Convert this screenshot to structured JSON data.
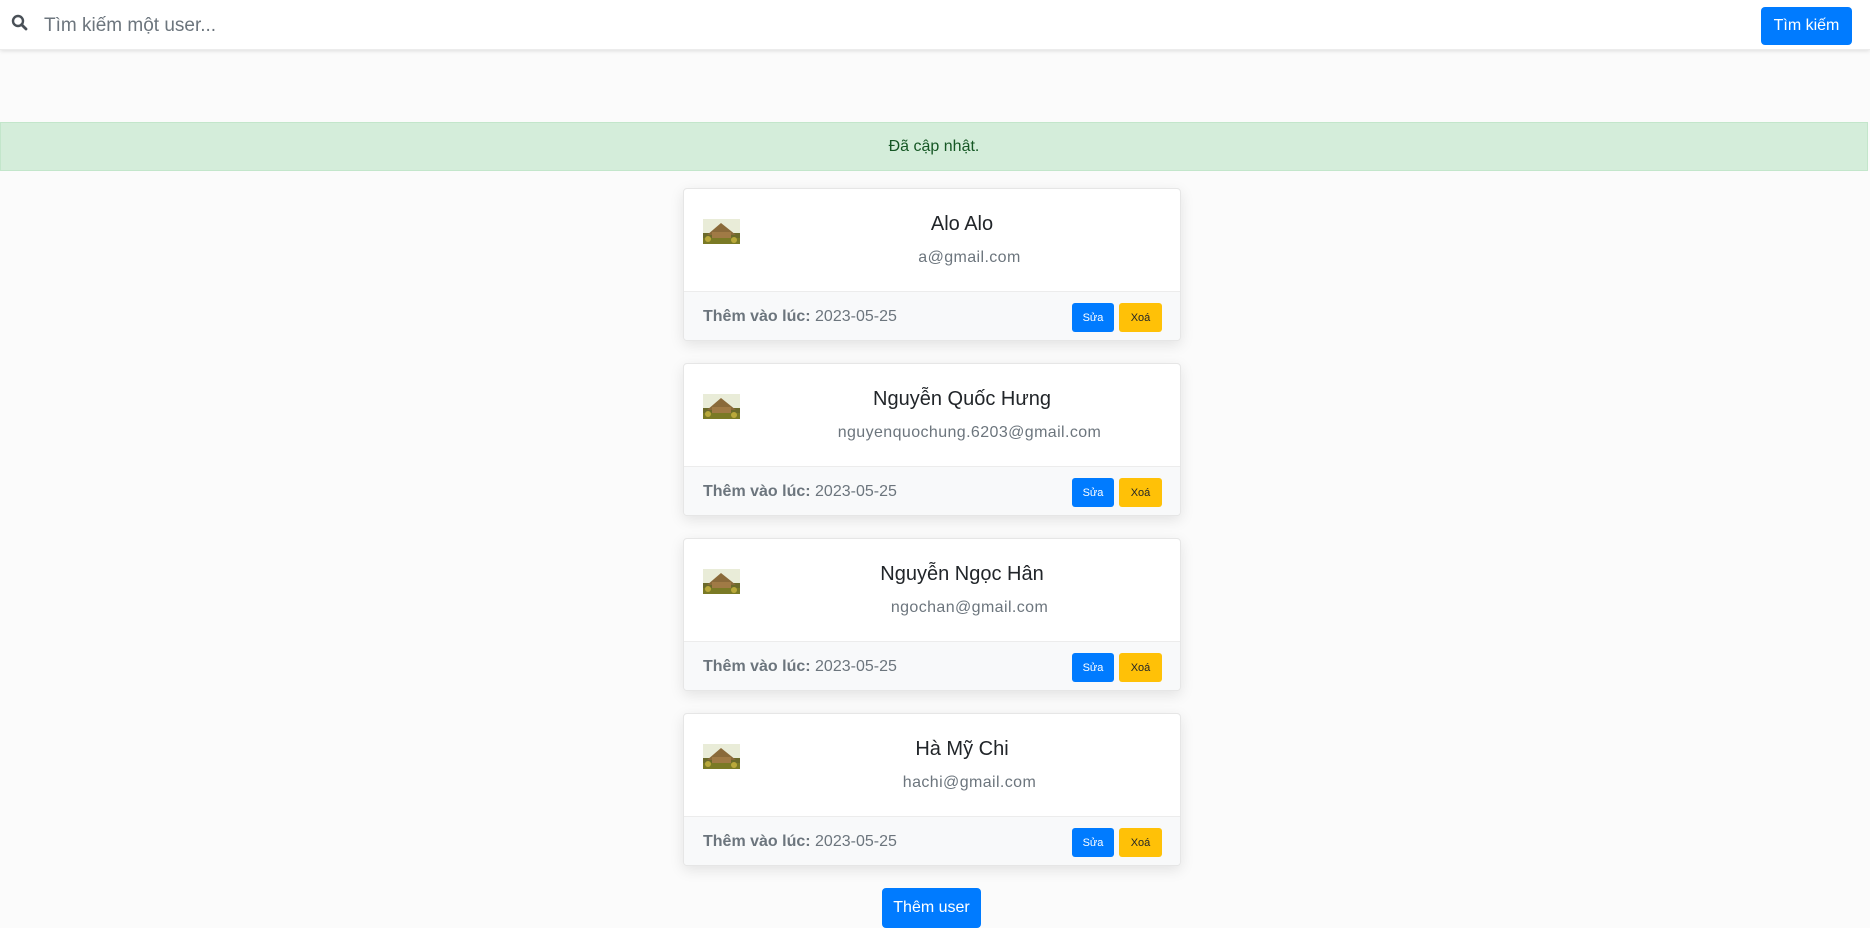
{
  "search": {
    "placeholder": "Tìm kiếm một user...",
    "button_label": "Tìm kiếm"
  },
  "alert": {
    "message": "Đã cập nhật."
  },
  "colors": {
    "primary": "#007bff",
    "warning": "#ffc107",
    "success_bg": "#d4edda",
    "success_text": "#155724"
  },
  "users": [
    {
      "name": "Alo Alo",
      "email": "a@gmail.com",
      "added_label": "Thêm vào lúc:",
      "added_date": "2023-05-25",
      "edit_label": "Sửa",
      "delete_label": "Xoá"
    },
    {
      "name": "Nguyễn Quốc Hưng",
      "email": "nguyenquochung.6203@gmail.com",
      "added_label": "Thêm vào lúc:",
      "added_date": "2023-05-25",
      "edit_label": "Sửa",
      "delete_label": "Xoá"
    },
    {
      "name": "Nguyễn Ngọc Hân",
      "email": "ngochan@gmail.com",
      "added_label": "Thêm vào lúc:",
      "added_date": "2023-05-25",
      "edit_label": "Sửa",
      "delete_label": "Xoá"
    },
    {
      "name": "Hà Mỹ Chi",
      "email": "hachi@gmail.com",
      "added_label": "Thêm vào lúc:",
      "added_date": "2023-05-25",
      "edit_label": "Sửa",
      "delete_label": "Xoá"
    }
  ],
  "add_user_label": "Thêm user"
}
